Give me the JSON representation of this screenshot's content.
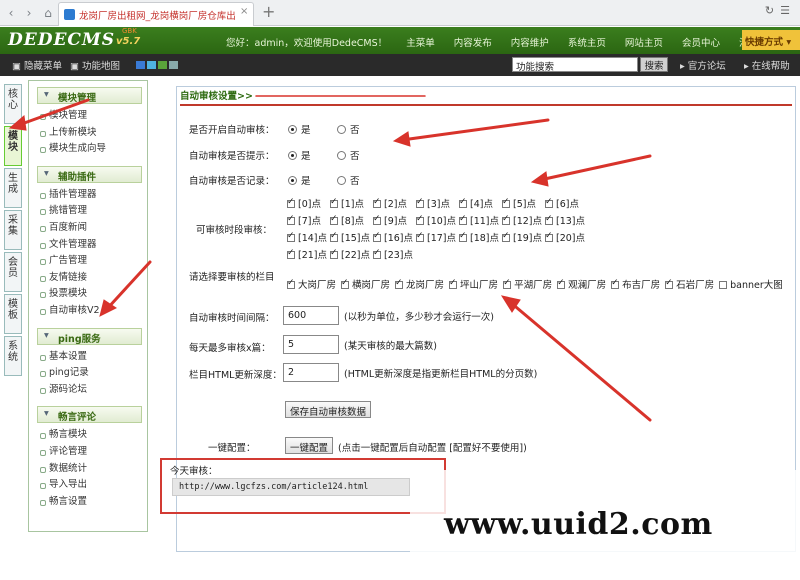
{
  "browser": {
    "tab_title": "龙岗厂房出租网_龙岗横岗厂房仓库出",
    "tab_close": "×",
    "new_tab": "+",
    "back_icon": "back-icon",
    "forward_icon": "forward-icon",
    "reload_icon": "reload-icon",
    "home_icon": "home-icon"
  },
  "header": {
    "logo": "DEDECMS",
    "version": "v5.7",
    "beta": "GBK",
    "welcome": "您好：admin，欢迎使用DedeCMS！",
    "nav": [
      "主菜单",
      "内容发布",
      "内容维护",
      "系统主页",
      "网站主页",
      "会员中心",
      "注销"
    ],
    "quick": "快捷方式"
  },
  "toolbar": {
    "hide_menu": "隐藏菜单",
    "site_map": "功能地图",
    "search_value": "功能搜索",
    "search_button": "搜索",
    "forum": "官方论坛",
    "help": "在线帮助"
  },
  "vtabs": [
    "核心",
    "模块",
    "生成",
    "采集",
    "会员",
    "模板",
    "系统"
  ],
  "menu": [
    {
      "title": "模块管理",
      "items": [
        "模块管理",
        "上传新模块",
        "模块生成向导"
      ]
    },
    {
      "title": "辅助插件",
      "items": [
        "插件管理器",
        "挑错管理",
        "百度新闻",
        "文件管理器",
        "广告管理",
        "友情链接",
        "投票模块",
        "自动审核V2"
      ]
    },
    {
      "title": "ping服务",
      "items": [
        "基本设置",
        "ping记录",
        "源码论坛"
      ]
    },
    {
      "title": "畅言评论",
      "items": [
        "畅言模块",
        "评论管理",
        "数据统计",
        "导入导出",
        "畅言设置"
      ]
    }
  ],
  "main": {
    "title": "自动审核设置>>",
    "q1": "是否开启自动审核：",
    "q2": "自动审核是否提示：",
    "q3": "自动审核是否记录：",
    "yes": "是",
    "no": "否",
    "hours_label": "可审核时段审核：",
    "hours": [
      "[0]点",
      "[1]点",
      "[2]点",
      "[3]点",
      "[4]点",
      "[5]点",
      "[6]点",
      "[7]点",
      "[8]点",
      "[9]点",
      "[10]点",
      "[11]点",
      "[12]点",
      "[13]点",
      "[14]点",
      "[15]点",
      "[16]点",
      "[17]点",
      "[18]点",
      "[19]点",
      "[20]点",
      "[21]点",
      "[22]点",
      "[23]点"
    ],
    "cat_label": "请选择要审核的栏目",
    "cats": [
      "大岗厂房",
      "横岗厂房",
      "龙岗厂房",
      "坪山厂房",
      "平湖厂房",
      "观澜厂房",
      "布吉厂房",
      "石岩厂房",
      "banner大图"
    ],
    "interval_label": "自动审核时间间隔：",
    "interval_value": "600",
    "interval_note": "(以秒为单位，多少秒才会运行一次)",
    "max_label": "每天最多审核x篇：",
    "max_value": "5",
    "max_note": "(某天审核的最大篇数)",
    "depth_label": "栏目HTML更新深度：",
    "depth_value": "2",
    "depth_note": "(HTML更新深度是指更新栏目HTML的分页数)",
    "save_button": "保存自动审核数据",
    "oneclick_label": "一键配置：",
    "oneclick_button": "一键配置",
    "oneclick_note": "(点击一键配置后自动配置 [配置好不要使用])",
    "today_label": "今天审核：",
    "today_url": "http://www.lgcfzs.com/article124.html"
  },
  "watermark": "www.uuid2.com"
}
